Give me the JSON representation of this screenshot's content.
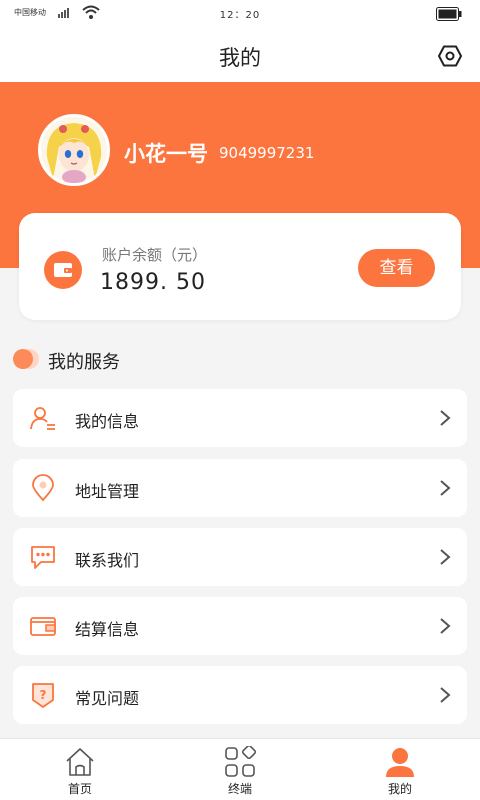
{
  "status_bar": {
    "carrier": "中国移动",
    "time": "12：20"
  },
  "nav": {
    "title": "我的",
    "settings_icon": "hexagon-settings-icon"
  },
  "profile": {
    "name": "小花一号",
    "phone": "9049997231"
  },
  "balance": {
    "label": "账户余额（元）",
    "value": "1899. 50",
    "button": "查看"
  },
  "services": {
    "title": "我的服务",
    "items": [
      {
        "label": "我的信息",
        "icon": "user-info-icon"
      },
      {
        "label": "地址管理",
        "icon": "location-pin-icon"
      },
      {
        "label": "联系我们",
        "icon": "chat-bubble-icon"
      },
      {
        "label": "结算信息",
        "icon": "wallet-card-icon"
      },
      {
        "label": "常见问题",
        "icon": "question-shield-icon"
      }
    ]
  },
  "tab_bar": {
    "tabs": [
      {
        "label": "首页",
        "icon": "home-icon",
        "active": false
      },
      {
        "label": "终端",
        "icon": "grid-icon",
        "active": false
      },
      {
        "label": "我的",
        "icon": "person-icon",
        "active": true
      }
    ]
  },
  "colors": {
    "accent": "#fc743e",
    "background": "#f4f4f4",
    "card": "#ffffff"
  }
}
